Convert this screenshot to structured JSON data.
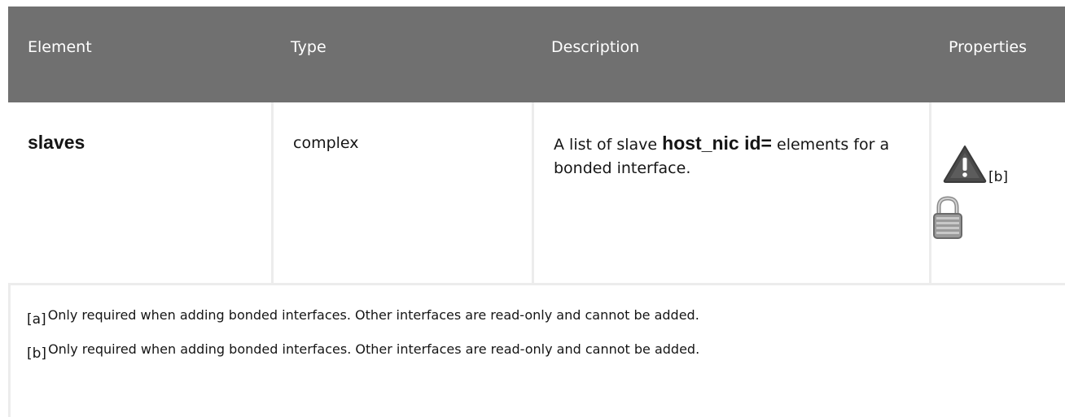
{
  "table": {
    "headers": [
      "Element",
      "Type",
      "Description",
      "Properties"
    ],
    "rows": [
      {
        "element": "slaves",
        "type": "complex",
        "description_prefix": "A list of slave ",
        "description_code": "host_nic id=",
        "description_suffix": " elements for a bonded interface.",
        "properties_footnote_ref": "[b]",
        "properties_icons": [
          "warning-icon",
          "lock-icon"
        ]
      }
    ]
  },
  "footnotes": [
    {
      "mark": "[a]",
      "text": "Only required when adding bonded interfaces. Other interfaces are read-only and cannot be added."
    },
    {
      "mark": "[b]",
      "text": "Only required when adding bonded interfaces. Other interfaces are read-only and cannot be added."
    }
  ],
  "colors": {
    "header_bg": "#707070",
    "header_text": "#ffffff",
    "grid": "#ececec"
  }
}
